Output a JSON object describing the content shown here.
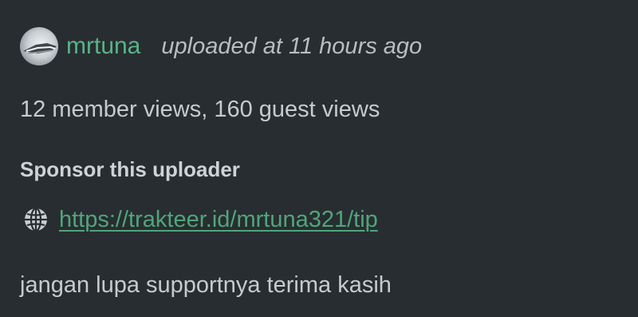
{
  "uploader": {
    "avatar_icon": "user-avatar",
    "username": "mrtuna",
    "uploaded_text": "uploaded at 11 hours ago"
  },
  "stats": {
    "views_text": "12 member views, 160 guest views"
  },
  "sponsor": {
    "heading": "Sponsor this uploader",
    "link_icon": "globe-icon",
    "link_url": "https://trakteer.id/mrtuna321/tip"
  },
  "description": {
    "text": "jangan lupa supportnya terima kasih"
  },
  "colors": {
    "background": "#282d31",
    "username": "#58b486",
    "link": "#50a57a",
    "text": "#c5cbcf"
  }
}
